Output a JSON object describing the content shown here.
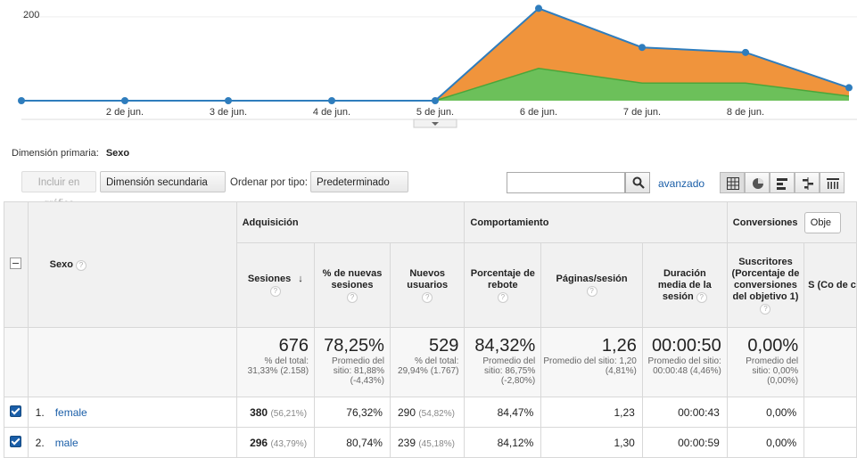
{
  "chart_data": {
    "type": "area",
    "categories": [
      "",
      "2 de jun.",
      "3 de jun.",
      "4 de jun.",
      "5 de jun.",
      "6 de jun.",
      "7 de jun.",
      "8 de jun.",
      ""
    ],
    "series": [
      {
        "name": "female",
        "values": [
          0,
          0,
          0,
          0,
          0,
          143,
          85,
          73,
          20
        ],
        "color": "#f0943c"
      },
      {
        "name": "male",
        "values": [
          0,
          0,
          0,
          0,
          0,
          77,
          42,
          42,
          11
        ],
        "color": "#6cc05a"
      }
    ],
    "total": [
      0,
      0,
      0,
      0,
      0,
      220,
      127,
      115,
      31
    ],
    "ylim": [
      0,
      240
    ],
    "yticks": [
      200
    ],
    "line_color": "#2f7dbd"
  },
  "dimension": {
    "label": "Dimensión primaria:",
    "value": "Sexo"
  },
  "toolbar": {
    "plot_button": "Incluir en gráfico",
    "secondary_dim": "Dimensión secundaria",
    "sort_label": "Ordenar por tipo:",
    "sort_value": "Predeterminado",
    "search_placeholder": "",
    "advanced": "avanzado",
    "view_icons": [
      "table-view-icon",
      "pie-view-icon",
      "performance-view-icon",
      "comparison-view-icon",
      "pivot-view-icon"
    ]
  },
  "table": {
    "groups": {
      "adq": "Adquisición",
      "comp": "Comportamiento",
      "conv": "Conversiones",
      "conv_select": "Obje"
    },
    "dim_header": "Sexo",
    "columns": [
      "Sesiones",
      "% de nuevas sesiones",
      "Nuevos usuarios",
      "Porcentaje de rebote",
      "Páginas/sesión",
      "Duración media de la sesión",
      "Suscritores (Porcentaje de conversiones del objetivo 1)",
      "S (Co de c"
    ],
    "totals": [
      {
        "value": "676",
        "note": "% del total: 31,33% (2.158)"
      },
      {
        "value": "78,25%",
        "note": "Promedio del sitio: 81,88% (-4,43%)"
      },
      {
        "value": "529",
        "note": "% del total: 29,94% (1.767)"
      },
      {
        "value": "84,32%",
        "note": "Promedio del sitio: 86,75% (-2,80%)"
      },
      {
        "value": "1,26",
        "note": "Promedio del sitio: 1,20 (4,81%)"
      },
      {
        "value": "00:00:50",
        "note": "Promedio del sitio: 00:00:48 (4,46%)"
      },
      {
        "value": "0,00%",
        "note": "Promedio del sitio: 0,00% (0,00%)"
      }
    ],
    "rows": [
      {
        "idx": "1.",
        "name": "female",
        "sessions": "380",
        "sessions_pct": "(56,21%)",
        "new_pct": "76,32%",
        "new_users": "290",
        "new_users_pct": "(54,82%)",
        "bounce": "84,47%",
        "pages": "1,23",
        "duration": "00:00:43",
        "conv": "0,00%"
      },
      {
        "idx": "2.",
        "name": "male",
        "sessions": "296",
        "sessions_pct": "(43,79%)",
        "new_pct": "80,74%",
        "new_users": "239",
        "new_users_pct": "(45,18%)",
        "bounce": "84,12%",
        "pages": "1,30",
        "duration": "00:00:59",
        "conv": "0,00%"
      }
    ]
  }
}
